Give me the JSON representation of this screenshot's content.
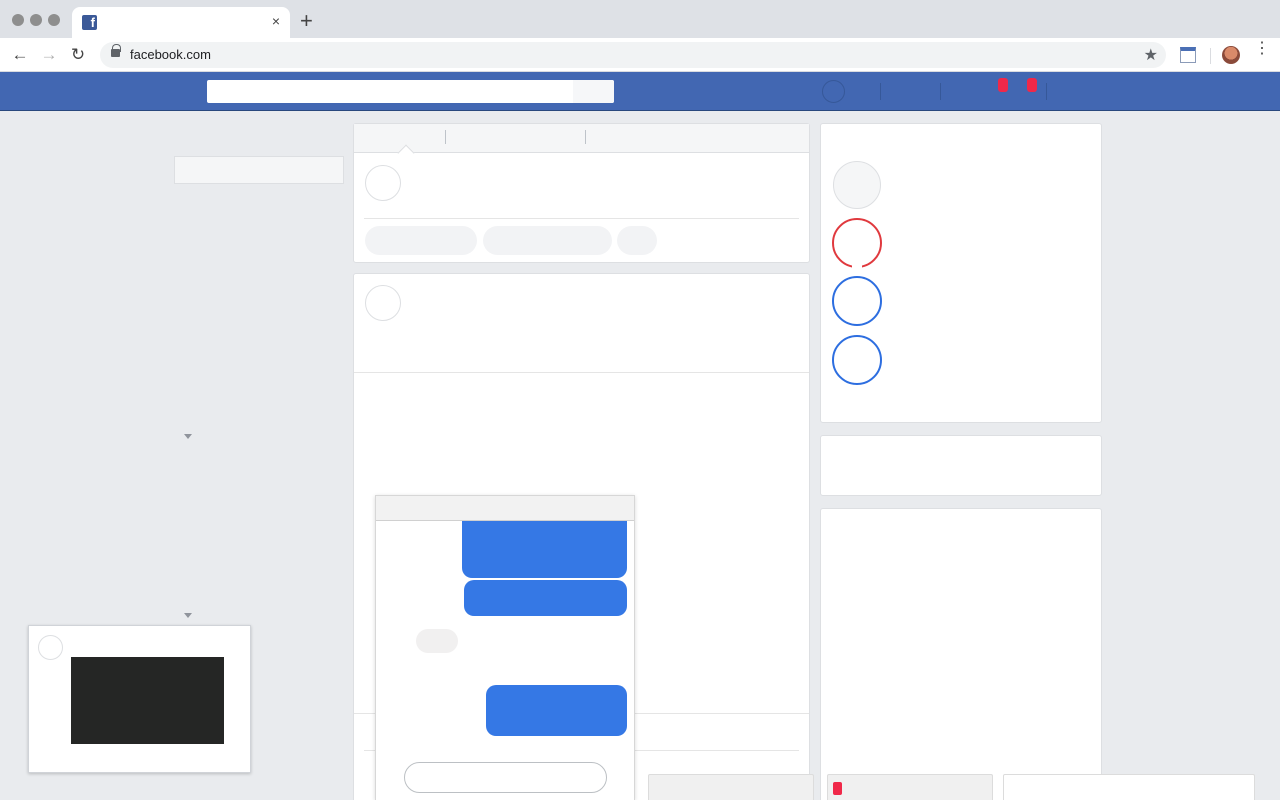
{
  "browser": {
    "tab": {
      "favicon": "f",
      "close_glyph": "×"
    },
    "new_tab_glyph": "+",
    "nav": {
      "back_glyph": "←",
      "forward_glyph": "→",
      "reload_glyph": "↻"
    },
    "address_bar": {
      "url": "facebook.com",
      "bookmark_glyph": "★"
    },
    "menu_glyph": "⋮"
  },
  "colors": {
    "facebook_blue": "#4267b2",
    "message_blue": "#3578e5",
    "notification_red": "#f02849",
    "story_ring_red": "#e0393e",
    "story_ring_blue": "#2d6ee0"
  },
  "icons": {
    "back": "arrow-left-icon",
    "forward": "arrow-right-icon",
    "reload": "reload-icon",
    "lock": "lock-icon",
    "bookmark": "star-icon",
    "extension": "extension-icon",
    "menu": "kebab-menu-icon",
    "favicon": "facebook-icon"
  }
}
